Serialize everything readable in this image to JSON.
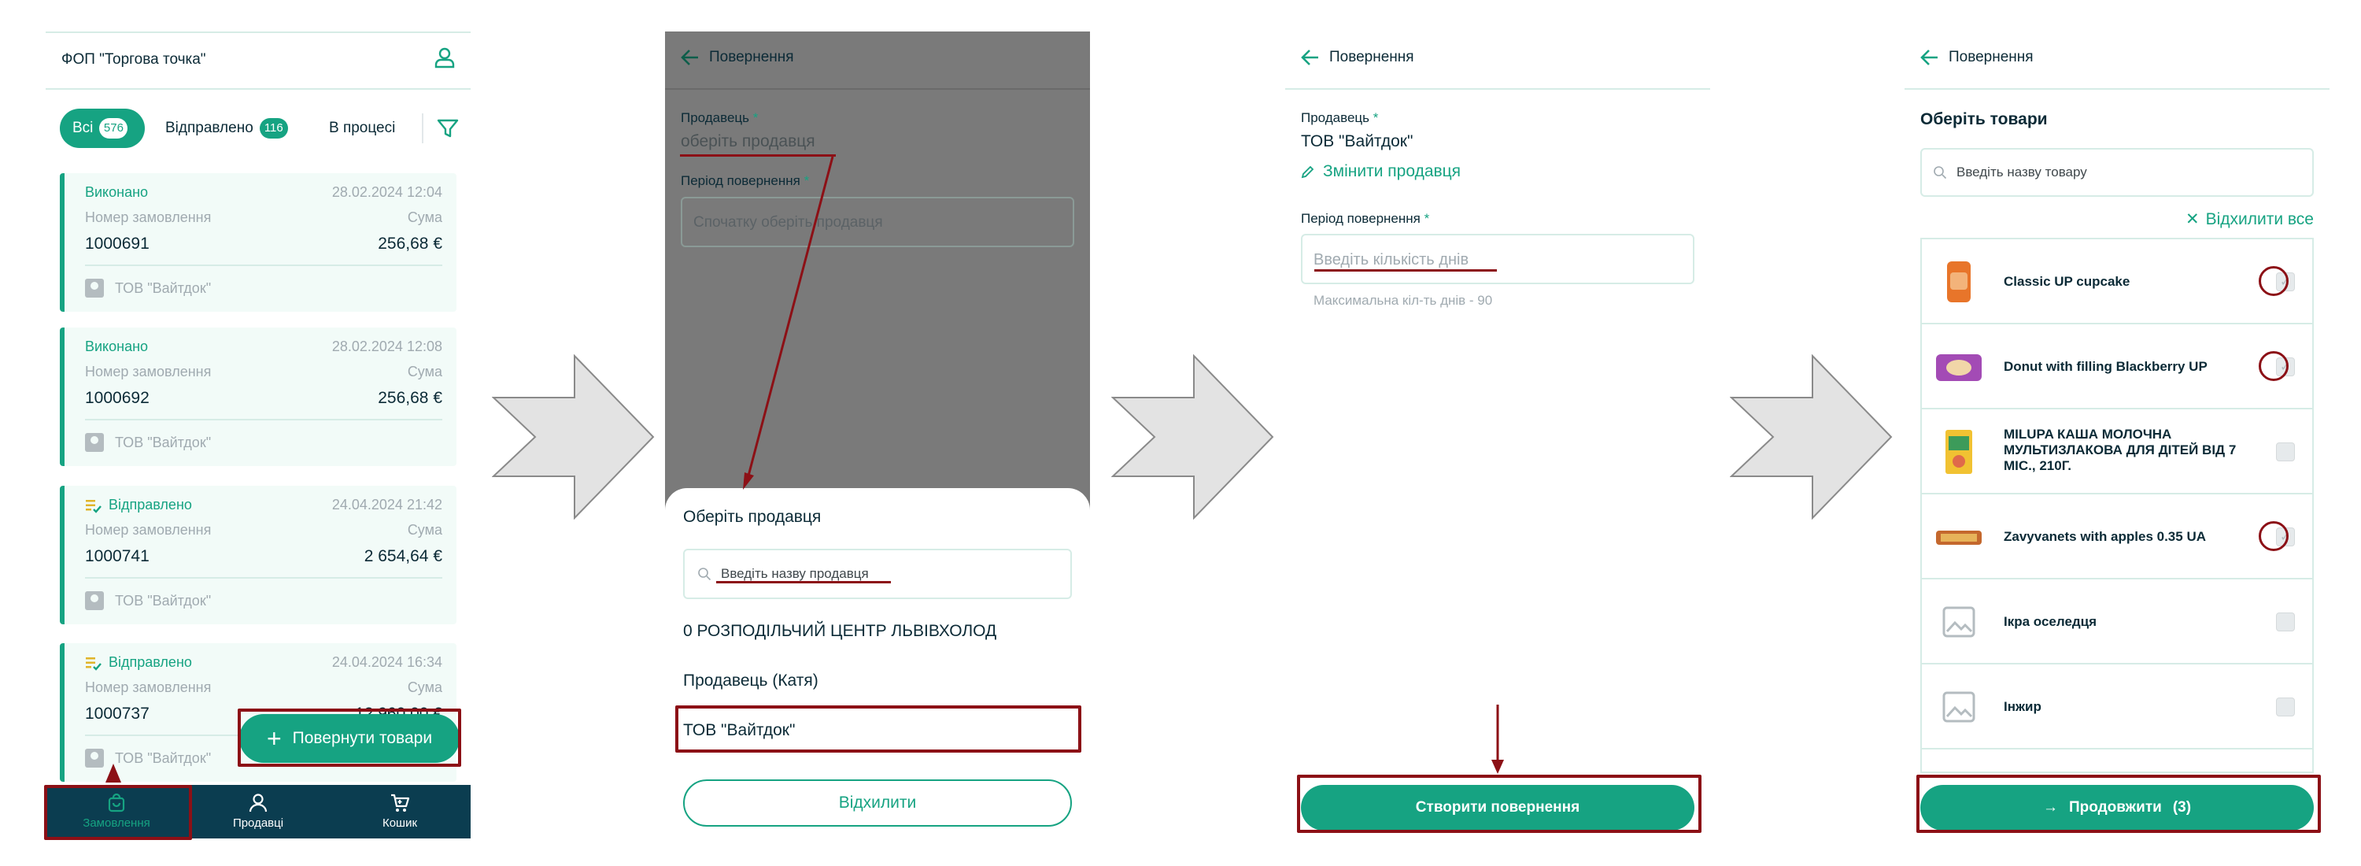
{
  "screen1": {
    "title": "ФОП \"Торгова точка\"",
    "tabs": [
      {
        "label": "Всі",
        "count": "576"
      },
      {
        "label": "Відправлено",
        "count": "116"
      },
      {
        "label": "В процесі"
      }
    ],
    "orders": [
      {
        "status": "Виконано",
        "date": "28.02.2024 12:04",
        "number_label": "Номер замовлення",
        "sum_label": "Сума",
        "number": "1000691",
        "sum": "256,68 €",
        "seller": "ТОВ \"Вайтдок\""
      },
      {
        "status": "Виконано",
        "date": "28.02.2024 12:08",
        "number_label": "Номер замовлення",
        "sum_label": "Сума",
        "number": "1000692",
        "sum": "256,68 €",
        "seller": "ТОВ \"Вайтдок\""
      },
      {
        "status": "Відправлено",
        "date": "24.04.2024 21:42",
        "number_label": "Номер замовлення",
        "sum_label": "Сума",
        "number": "1000741",
        "sum": "2 654,64 €",
        "seller": "ТОВ \"Вайтдок\""
      },
      {
        "status": "Відправлено",
        "date": "24.04.2024 16:34",
        "number_label": "Номер замовлення",
        "sum_label": "Сума",
        "number": "1000737",
        "sum": "12 960,00 €",
        "seller": "ТОВ \"Вайтдок\""
      }
    ],
    "fab_label": "Повернути товари",
    "nav": [
      {
        "label": "Замовлення",
        "icon": "bag-icon"
      },
      {
        "label": "Продавці",
        "icon": "person-icon"
      },
      {
        "label": "Кошик",
        "icon": "cart-icon"
      }
    ]
  },
  "screen2": {
    "back_label": "Повернення",
    "seller_label": "Продавець",
    "seller_placeholder": "оберіть продавця",
    "period_label": "Період повернення",
    "period_placeholder": "Спочатку оберіть продавця",
    "sheet_title": "Оберіть продавця",
    "search_placeholder": "Введіть назву продавця",
    "options": [
      "0 РОЗПОДІЛЬЧИЙ ЦЕНТР ЛЬВІВХОЛОД",
      "Продавець (Катя)",
      "ТОВ \"Вайтдок\""
    ],
    "reject_label": "Відхилити"
  },
  "screen3": {
    "back_label": "Повернення",
    "seller_label": "Продавець",
    "seller_name": "ТОВ \"Вайтдок\"",
    "change_label": "Змінити продавця",
    "period_label": "Період повернення",
    "days_placeholder": "Введіть кількість днів",
    "hint": "Максимальна кіл-ть днів - 90",
    "create_label": "Створити повернення"
  },
  "screen4": {
    "back_label": "Повернення",
    "section_title": "Оберіть товари",
    "search_placeholder": "Введіть назву товару",
    "reject_all_label": "Відхилити все",
    "products": [
      {
        "name": "Classic UP cupcake",
        "checked": true
      },
      {
        "name": "Donut with filling Blackberry UP",
        "checked": true
      },
      {
        "name": "MILUPA КАША МОЛОЧНА МУЛЬТИЗЛАКОВА ДЛЯ ДІТЕЙ ВІД 7 МІС., 210Г.",
        "checked": false
      },
      {
        "name": "Zavyvanets with apples 0.35 UA",
        "checked": true
      },
      {
        "name": "Ікра оселедця",
        "checked": false
      },
      {
        "name": "Інжир",
        "checked": false
      }
    ],
    "continue_label": "Продовжити",
    "continue_count": "(3)"
  },
  "colors": {
    "accent": "#16a382",
    "nav_bg": "#0b3d50",
    "highlight": "#8c1016",
    "card_bg": "#f2fbf8"
  }
}
